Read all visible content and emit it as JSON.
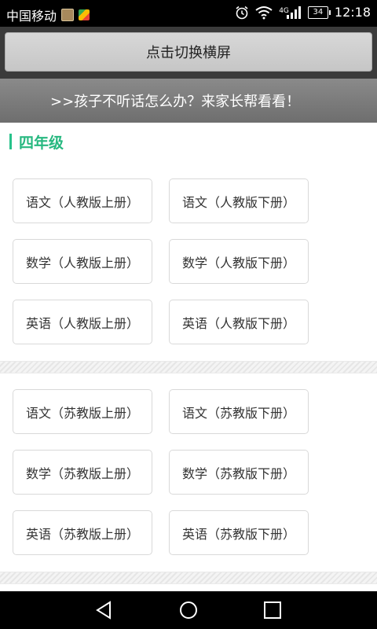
{
  "status_bar": {
    "carrier": "中国移动",
    "network": "4G",
    "battery": "34",
    "time": "12:18"
  },
  "toolbar": {
    "switch_label": "点击切换横屏"
  },
  "banner": {
    "text": ">>孩子不听话怎么办？来家长帮看看！"
  },
  "grade": {
    "title": "四年级"
  },
  "section1": {
    "books": [
      "语文（人教版上册）",
      "语文（人教版下册）",
      "数学（人教版上册）",
      "数学（人教版下册）",
      "英语（人教版上册）",
      "英语（人教版下册）"
    ]
  },
  "section2": {
    "books": [
      "语文（苏教版上册）",
      "语文（苏教版下册）",
      "数学（苏教版上册）",
      "数学（苏教版下册）",
      "英语（苏教版上册）",
      "英语（苏教版下册）"
    ]
  },
  "nav": {
    "back_icon": "back-triangle-icon",
    "home_icon": "home-circle-icon",
    "recents_icon": "recents-square-icon"
  },
  "colors": {
    "accent": "#27b880",
    "status_bar": "#000000",
    "banner": "#7c7c7c"
  }
}
